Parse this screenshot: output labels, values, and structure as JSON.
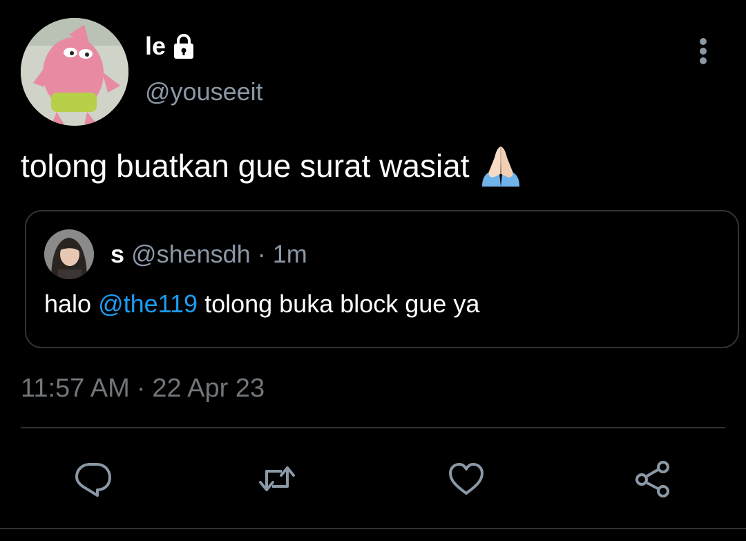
{
  "author": {
    "display_name": "le",
    "handle": "@youseeit",
    "protected_icon": "lock-icon",
    "avatar_icon": "patrick-star-avatar"
  },
  "tweet": {
    "text": "tolong buatkan gue surat wasiat",
    "emoji": "folded-hands-icon"
  },
  "quote": {
    "name": "s",
    "handle": "@shensdh",
    "separator": "·",
    "time": "1m",
    "text_before": "halo ",
    "mention": "@the119",
    "text_after": " tolong buka block gue ya"
  },
  "meta": {
    "time": "11:57 AM",
    "separator": "·",
    "date": "22 Apr 23"
  },
  "actions": [
    "reply-icon",
    "retweet-icon",
    "like-icon",
    "share-icon"
  ],
  "colors": {
    "background": "#000000",
    "text": "#ffffff",
    "secondary": "#8b98a5",
    "accent": "#1d9bf0",
    "border": "#2f3336"
  }
}
